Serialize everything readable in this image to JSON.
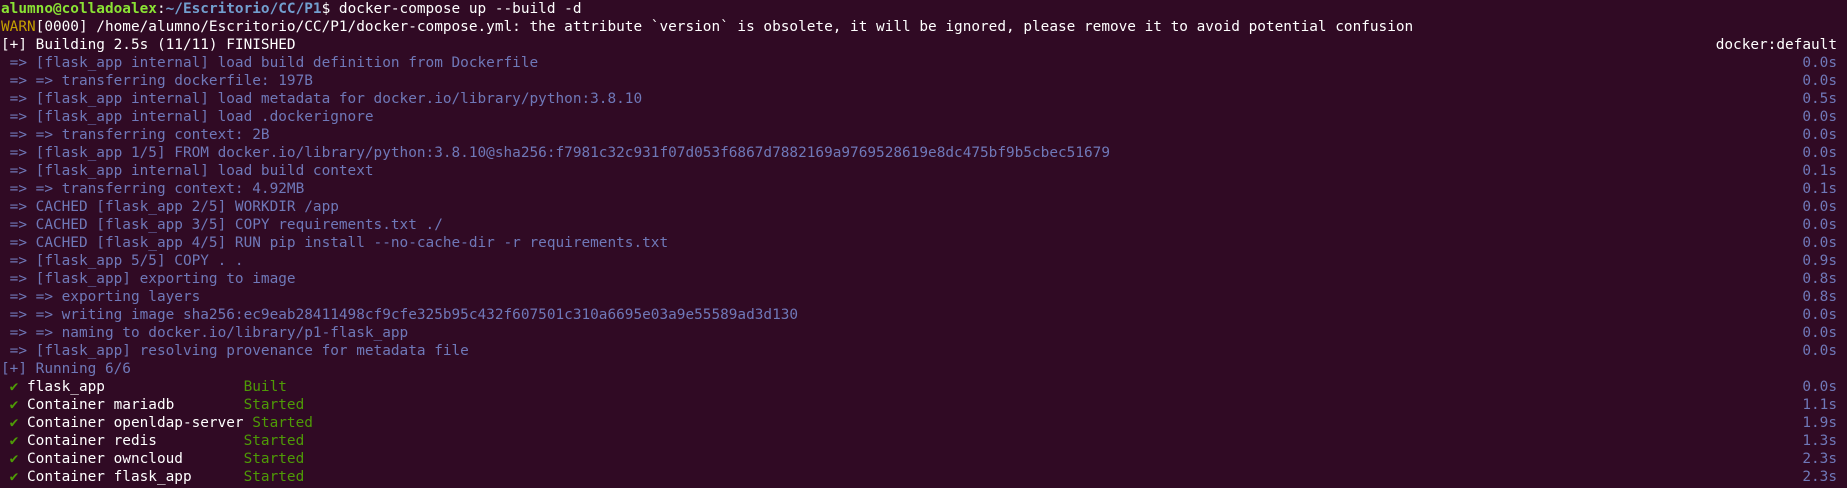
{
  "prompt": {
    "user_host": "alumno@colladoalex",
    "separator": ":",
    "path": "~/Escritorio/CC/P1",
    "symbol": "$ ",
    "command": "docker-compose up --build -d"
  },
  "warning": {
    "tag": "WARN",
    "message": "[0000] /home/alumno/Escritorio/CC/P1/docker-compose.yml: the attribute `version` is obsolete, it will be ignored, please remove it to avoid potential confusion"
  },
  "build_header": {
    "text": "[+] Building 2.5s (11/11) FINISHED",
    "context": "docker:default"
  },
  "build_steps": [
    {
      "text": " => [flask_app internal] load build definition from Dockerfile",
      "time": "0.0s"
    },
    {
      "text": " => => transferring dockerfile: 197B",
      "time": "0.0s"
    },
    {
      "text": " => [flask_app internal] load metadata for docker.io/library/python:3.8.10",
      "time": "0.5s"
    },
    {
      "text": " => [flask_app internal] load .dockerignore",
      "time": "0.0s"
    },
    {
      "text": " => => transferring context: 2B",
      "time": "0.0s"
    },
    {
      "text": " => [flask_app 1/5] FROM docker.io/library/python:3.8.10@sha256:f7981c32c931f07d053f6867d7882169a9769528619e8dc475bf9b5cbec51679",
      "time": "0.0s"
    },
    {
      "text": " => [flask_app internal] load build context",
      "time": "0.1s"
    },
    {
      "text": " => => transferring context: 4.92MB",
      "time": "0.1s"
    },
    {
      "text": " => CACHED [flask_app 2/5] WORKDIR /app",
      "time": "0.0s"
    },
    {
      "text": " => CACHED [flask_app 3/5] COPY requirements.txt ./",
      "time": "0.0s"
    },
    {
      "text": " => CACHED [flask_app 4/5] RUN pip install --no-cache-dir -r requirements.txt",
      "time": "0.0s"
    },
    {
      "text": " => [flask_app 5/5] COPY . .",
      "time": "0.9s"
    },
    {
      "text": " => [flask_app] exporting to image",
      "time": "0.8s"
    },
    {
      "text": " => => exporting layers",
      "time": "0.8s"
    },
    {
      "text": " => => writing image sha256:ec9eab28411498cf9cfe325b95c432f607501c310a6695e03a9e55589ad3d130",
      "time": "0.0s"
    },
    {
      "text": " => => naming to docker.io/library/p1-flask_app",
      "time": "0.0s"
    },
    {
      "text": " => [flask_app] resolving provenance for metadata file",
      "time": "0.0s"
    }
  ],
  "running_header": "[+] Running 6/6",
  "services": [
    {
      "check": " ✔",
      "name": " flask_app                ",
      "status": "Built",
      "time": "0.0s"
    },
    {
      "check": " ✔",
      "name": " Container mariadb        ",
      "status": "Started",
      "time": "1.1s"
    },
    {
      "check": " ✔",
      "name": " Container openldap-server ",
      "status": "Started",
      "time": "1.9s"
    },
    {
      "check": " ✔",
      "name": " Container redis          ",
      "status": "Started",
      "time": "1.3s"
    },
    {
      "check": " ✔",
      "name": " Container owncloud       ",
      "status": "Started",
      "time": "2.3s"
    },
    {
      "check": " ✔",
      "name": " Container flask_app      ",
      "status": "Started",
      "time": "2.3s"
    }
  ],
  "colors": {
    "background": "#300a24",
    "prompt_user": "#8ae234",
    "prompt_path": "#729fcf",
    "warn": "#c4a000",
    "dim_text": "#6f78b8",
    "success": "#4e9a06"
  }
}
